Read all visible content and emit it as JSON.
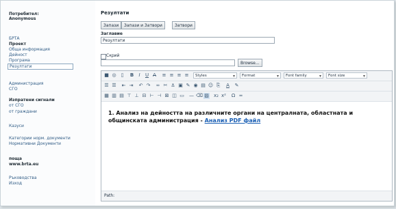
{
  "sidebar": {
    "user_label": "Потребител:",
    "user_name": "Anonymous",
    "items": [
      {
        "label": "БРТА"
      },
      {
        "label": "Проект"
      },
      {
        "label": "Обща информация"
      },
      {
        "label": "Дейност"
      },
      {
        "label": "Програма"
      },
      {
        "label": "Резултати"
      },
      {
        "label": "Администрация"
      },
      {
        "label": "СГО"
      },
      {
        "label": "Изпратени сигнали"
      },
      {
        "label": "от СГО"
      },
      {
        "label": "от граждани"
      },
      {
        "label": "Казуси"
      },
      {
        "label": "Категории норм. документи"
      },
      {
        "label": "Нормативни Документи"
      },
      {
        "label": "поща"
      },
      {
        "label": "www.brta.eu"
      },
      {
        "label": "Ръководства"
      },
      {
        "label": "Изход"
      }
    ]
  },
  "main": {
    "title": "Резултати",
    "buttons": {
      "save": "Запази",
      "save_close": "Запази и Затвори",
      "close": "Затвори"
    },
    "title_label": "Заглавие",
    "title_value": "Резултати",
    "hide_label": "Скрий",
    "browse_label": "Browse...",
    "toolbar": {
      "styles": "Styles",
      "format": "Format",
      "font_family": "Font family",
      "font_size": "Font size"
    },
    "content_text": "1. Анализ на дейността на различните органи на централната, областната и общинската администрация - ",
    "content_link": "Анализ PDF файл",
    "status_path": "Path:"
  }
}
